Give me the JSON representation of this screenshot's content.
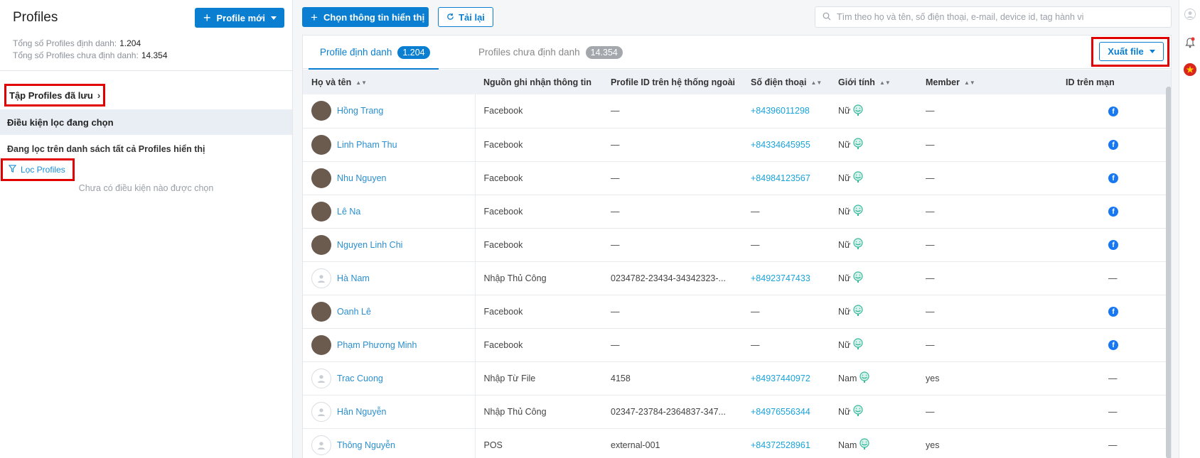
{
  "left": {
    "title": "Profiles",
    "new_button": "Profile mới",
    "stats": [
      {
        "label": "Tổng số Profiles định danh:",
        "value": "1.204"
      },
      {
        "label": "Tổng số Profiles chưa định danh:",
        "value": "14.354"
      }
    ],
    "saved_sets": "Tập Profiles đã lưu",
    "conditions_header": "Điều kiện lọc đang chọn",
    "filtering_on": "Đang lọc trên danh sách tất cả Profiles hiển thị",
    "filter_link": "Lọc Profiles",
    "empty_note": "Chưa có điều kiện nào được chọn"
  },
  "toolbar": {
    "select_button": "Chọn thông tin hiển thị",
    "reload_button": "Tải lại",
    "search_placeholder": "Tìm theo họ và tên, số điện thoại, e-mail, device id, tag hành vi"
  },
  "tabs": [
    {
      "label": "Profile định danh",
      "count": "1.204",
      "active": true
    },
    {
      "label": "Profiles chưa định danh",
      "count": "14.354",
      "active": false
    }
  ],
  "export_button": "Xuất file",
  "table": {
    "columns": [
      "Họ và tên",
      "Nguồn ghi nhận thông tin",
      "Profile ID trên hệ thống ngoài",
      "Số điện thoại",
      "Giới tính",
      "Member",
      "ID trên mạn"
    ],
    "rows": [
      {
        "name": "Hồng Trang",
        "source": "Facebook",
        "external_id": "—",
        "phone": "+84396011298",
        "gender": "Nữ",
        "member": "—",
        "social": "facebook",
        "avatar": "photo"
      },
      {
        "name": "Linh Pham Thu",
        "source": "Facebook",
        "external_id": "—",
        "phone": "+84334645955",
        "gender": "Nữ",
        "member": "—",
        "social": "facebook",
        "avatar": "photo"
      },
      {
        "name": "Nhu Nguyen",
        "source": "Facebook",
        "external_id": "—",
        "phone": "+84984123567",
        "gender": "Nữ",
        "member": "—",
        "social": "facebook",
        "avatar": "photo"
      },
      {
        "name": "Lê Na",
        "source": "Facebook",
        "external_id": "—",
        "phone": "—",
        "gender": "Nữ",
        "member": "—",
        "social": "facebook",
        "avatar": "photo"
      },
      {
        "name": "Nguyen Linh Chi",
        "source": "Facebook",
        "external_id": "—",
        "phone": "—",
        "gender": "Nữ",
        "member": "—",
        "social": "facebook",
        "avatar": "photo"
      },
      {
        "name": "Hà Nam",
        "source": "Nhập Thủ Công",
        "external_id": "0234782-23434-34342323-...",
        "phone": "+84923747433",
        "gender": "Nữ",
        "member": "—",
        "social": "—",
        "avatar": "placeholder"
      },
      {
        "name": "Oanh Lê",
        "source": "Facebook",
        "external_id": "—",
        "phone": "—",
        "gender": "Nữ",
        "member": "—",
        "social": "facebook",
        "avatar": "photo"
      },
      {
        "name": "Phạm Phương Minh",
        "source": "Facebook",
        "external_id": "—",
        "phone": "—",
        "gender": "Nữ",
        "member": "—",
        "social": "facebook",
        "avatar": "photo"
      },
      {
        "name": "Trac Cuong",
        "source": "Nhập Từ File",
        "external_id": "4158",
        "phone": "+84937440972",
        "gender": "Nam",
        "member": "yes",
        "social": "—",
        "avatar": "placeholder"
      },
      {
        "name": "Hân Nguyễn",
        "source": "Nhập Thủ Công",
        "external_id": "02347-23784-2364837-347...",
        "phone": "+84976556344",
        "gender": "Nữ",
        "member": "—",
        "social": "—",
        "avatar": "placeholder"
      },
      {
        "name": "Thông Nguyễn",
        "source": "POS",
        "external_id": "external-001",
        "phone": "+84372528961",
        "gender": "Nam",
        "member": "yes",
        "social": "—",
        "avatar": "placeholder"
      }
    ]
  },
  "colors": {
    "accent": "#0a7fd1",
    "highlight": "#e00000",
    "phone": "#1aa3d9",
    "facebook": "#1877f2"
  }
}
